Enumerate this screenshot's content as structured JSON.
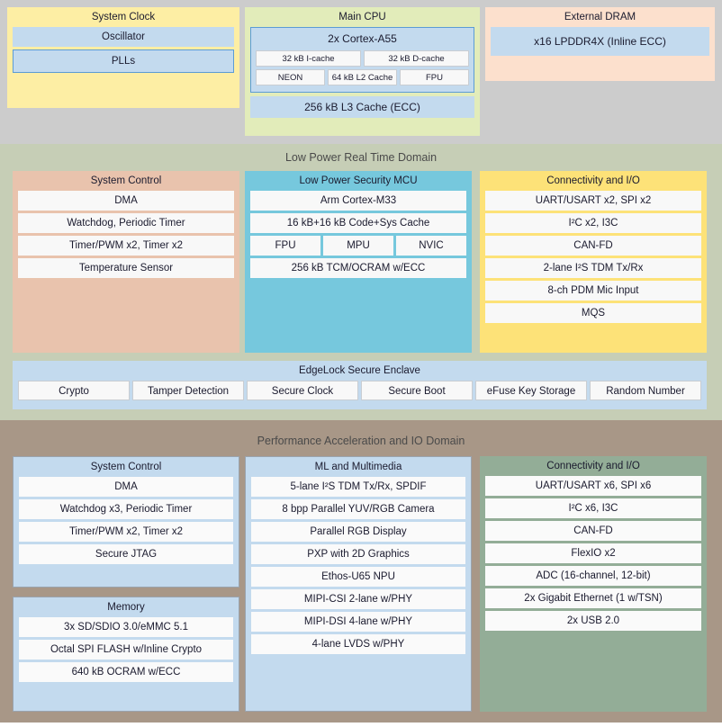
{
  "diagram": {
    "bands": {
      "top_label": "",
      "lp_label": "Low Power Real Time Domain",
      "perf_label": "Performance Acceleration and IO Domain"
    },
    "colors": {
      "clock_bg": "#fdeea4",
      "cpu_bg": "#e2ecba",
      "dram_bg": "#fce0cd",
      "lp_band": "#c6ceb6",
      "perf_band": "#a89787",
      "mcu_bg": "#76c8dd",
      "conn_lp_bg": "#fde278",
      "conn_pf_bg": "#93ad97",
      "sysctl_lp_bg": "#e9c3ad",
      "blue_block": "#c3daee",
      "top_band": "#cccccc"
    },
    "system_clock": {
      "title": "System Clock",
      "items": [
        "Oscillator",
        "PLLs"
      ]
    },
    "main_cpu": {
      "title": "Main CPU",
      "core_title": "2x Cortex-A55",
      "cache_row_1": [
        "32 kB I-cache",
        "32 kB D-cache"
      ],
      "cache_row_2": [
        "NEON",
        "64 kB L2 Cache",
        "FPU"
      ],
      "l3": "256 kB L3 Cache (ECC)"
    },
    "external_dram": {
      "title": "External DRAM",
      "items": [
        "x16 LPDDR4X (Inline ECC)"
      ]
    },
    "lp_system_control": {
      "title": "System Control",
      "items": [
        "DMA",
        "Watchdog, Periodic Timer",
        "Timer/PWM x2, Timer x2",
        "Temperature Sensor"
      ]
    },
    "lp_security_mcu": {
      "title": "Low Power Security MCU",
      "core": "Arm Cortex-M33",
      "cache": "16 kB+16 kB Code+Sys Cache",
      "units": [
        "FPU",
        "MPU",
        "NVIC"
      ],
      "tcm": "256 kB TCM/OCRAM w/ECC"
    },
    "lp_connectivity": {
      "title": "Connectivity and I/O",
      "items": [
        "UART/USART x2, SPI x2",
        "I²C x2, I3C",
        "CAN-FD",
        "2-lane I²S TDM Tx/Rx",
        "8-ch PDM Mic Input",
        "MQS"
      ]
    },
    "edgelock": {
      "title": "EdgeLock Secure Enclave",
      "items": [
        "Crypto",
        "Tamper Detection",
        "Secure Clock",
        "Secure Boot",
        "eFuse Key Storage",
        "Random Number"
      ]
    },
    "pf_system_control": {
      "title": "System Control",
      "items": [
        "DMA",
        "Watchdog x3, Periodic Timer",
        "Timer/PWM x2, Timer x2",
        "Secure JTAG"
      ]
    },
    "pf_memory": {
      "title": "Memory",
      "items": [
        "3x SD/SDIO 3.0/eMMC 5.1",
        "Octal SPI FLASH w/Inline Crypto",
        "640 kB OCRAM w/ECC"
      ]
    },
    "pf_ml_multimedia": {
      "title": "ML and Multimedia",
      "items": [
        "5-lane I²S TDM Tx/Rx, SPDIF",
        "8 bpp Parallel YUV/RGB Camera",
        "Parallel RGB Display",
        "PXP with 2D Graphics",
        "Ethos-U65 NPU",
        "MIPI-CSI 2-lane w/PHY",
        "MIPI-DSI 4-lane w/PHY",
        "4-lane LVDS w/PHY"
      ]
    },
    "pf_connectivity": {
      "title": "Connectivity and I/O",
      "items": [
        "UART/USART x6, SPI x6",
        "I²C x6, I3C",
        "CAN-FD",
        "FlexIO x2",
        "ADC (16-channel, 12-bit)",
        "2x Gigabit Ethernet (1 w/TSN)",
        "2x USB 2.0"
      ]
    }
  }
}
